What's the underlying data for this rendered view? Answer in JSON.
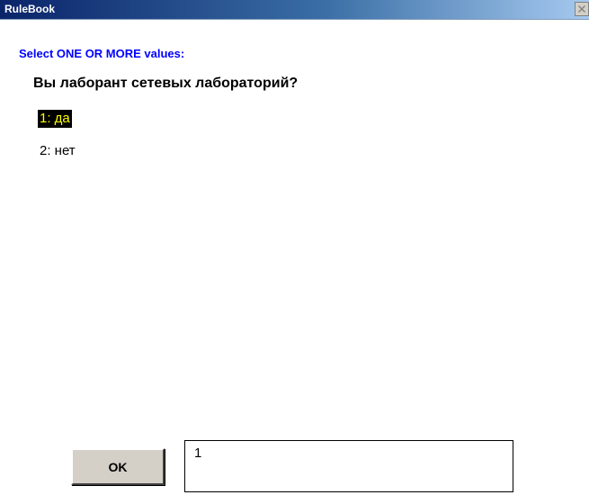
{
  "window": {
    "title": "RuleBook",
    "close_icon": "close-x-icon"
  },
  "prompt": "Select ONE OR MORE values:",
  "question": "Вы лаборант сетевых лабораторий?",
  "options": [
    {
      "label": "1:  да",
      "selected": true
    },
    {
      "label": "2:  нет",
      "selected": false
    }
  ],
  "ok_button_label": "OK",
  "input": {
    "value": "1"
  },
  "colors": {
    "prompt": "#0000ff",
    "selected_background": "#000000",
    "selected_text": "#ffff00",
    "title_bar": "#0a246a",
    "button_face": "#d4d0c8"
  }
}
